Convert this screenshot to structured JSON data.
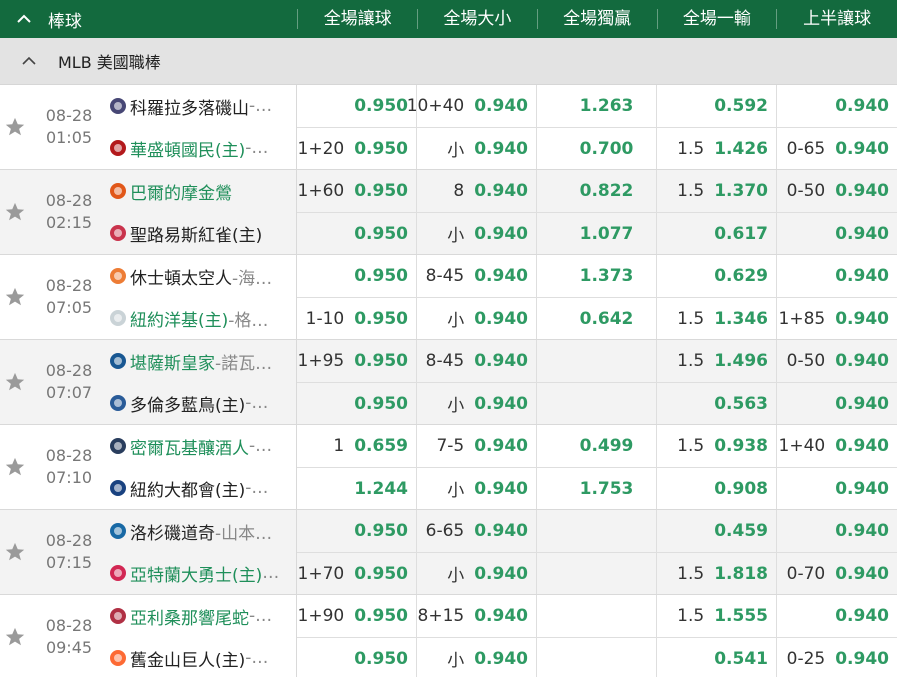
{
  "header": {
    "sport": "棒球",
    "columns": [
      "全場讓球",
      "全場大小",
      "全場獨贏",
      "全場一輸",
      "上半讓球"
    ]
  },
  "league": {
    "name": "MLB 美國職棒"
  },
  "matches": [
    {
      "date": "08-28",
      "time": "01:05",
      "teams": [
        {
          "name": "科羅拉多落磯山",
          "pitcher": " -…",
          "fav": false,
          "logo": "rockies-logo-icon"
        },
        {
          "name": "華盛頓國民(主)",
          "pitcher": " -…",
          "fav": true,
          "logo": "nationals-logo-icon"
        }
      ],
      "odds": [
        [
          {
            "line": "",
            "odds": "0.950"
          },
          {
            "line": "10+40",
            "odds": "0.940"
          },
          {
            "line": "",
            "odds": "1.263"
          },
          {
            "line": "",
            "odds": "0.592"
          },
          {
            "line": "",
            "odds": "0.940"
          }
        ],
        [
          {
            "line": "1+20",
            "odds": "0.950"
          },
          {
            "line": "小",
            "odds": "0.940"
          },
          {
            "line": "",
            "odds": "0.700"
          },
          {
            "line": "1.5",
            "odds": "1.426"
          },
          {
            "line": "0-65",
            "odds": "0.940"
          }
        ]
      ]
    },
    {
      "date": "08-28",
      "time": "02:15",
      "teams": [
        {
          "name": "巴爾的摩金鶯",
          "pitcher": "",
          "fav": true,
          "logo": "orioles-logo-icon"
        },
        {
          "name": "聖路易斯紅雀(主)",
          "pitcher": "",
          "fav": false,
          "logo": "cardinals-logo-icon"
        }
      ],
      "odds": [
        [
          {
            "line": "1+60",
            "odds": "0.950"
          },
          {
            "line": "8",
            "odds": "0.940"
          },
          {
            "line": "",
            "odds": "0.822"
          },
          {
            "line": "1.5",
            "odds": "1.370"
          },
          {
            "line": "0-50",
            "odds": "0.940"
          }
        ],
        [
          {
            "line": "",
            "odds": "0.950"
          },
          {
            "line": "小",
            "odds": "0.940"
          },
          {
            "line": "",
            "odds": "1.077"
          },
          {
            "line": "",
            "odds": "0.617"
          },
          {
            "line": "",
            "odds": "0.940"
          }
        ]
      ]
    },
    {
      "date": "08-28",
      "time": "07:05",
      "teams": [
        {
          "name": "休士頓太空人",
          "pitcher": " -海…",
          "fav": false,
          "logo": "astros-logo-icon"
        },
        {
          "name": "紐約洋基(主)",
          "pitcher": " -格…",
          "fav": true,
          "logo": "yankees-logo-icon"
        }
      ],
      "odds": [
        [
          {
            "line": "",
            "odds": "0.950"
          },
          {
            "line": "8-45",
            "odds": "0.940"
          },
          {
            "line": "",
            "odds": "1.373"
          },
          {
            "line": "",
            "odds": "0.629"
          },
          {
            "line": "",
            "odds": "0.940"
          }
        ],
        [
          {
            "line": "1-10",
            "odds": "0.950"
          },
          {
            "line": "小",
            "odds": "0.940"
          },
          {
            "line": "",
            "odds": "0.642"
          },
          {
            "line": "1.5",
            "odds": "1.346"
          },
          {
            "line": "1+85",
            "odds": "0.940"
          }
        ]
      ]
    },
    {
      "date": "08-28",
      "time": "07:07",
      "teams": [
        {
          "name": "堪薩斯皇家",
          "pitcher": " -諾瓦…",
          "fav": true,
          "logo": "royals-logo-icon"
        },
        {
          "name": "多倫多藍鳥(主)",
          "pitcher": " -…",
          "fav": false,
          "logo": "bluejays-logo-icon"
        }
      ],
      "odds": [
        [
          {
            "line": "1+95",
            "odds": "0.950"
          },
          {
            "line": "8-45",
            "odds": "0.940"
          },
          {
            "line": "",
            "odds": ""
          },
          {
            "line": "1.5",
            "odds": "1.496"
          },
          {
            "line": "0-50",
            "odds": "0.940"
          }
        ],
        [
          {
            "line": "",
            "odds": "0.950"
          },
          {
            "line": "小",
            "odds": "0.940"
          },
          {
            "line": "",
            "odds": ""
          },
          {
            "line": "",
            "odds": "0.563"
          },
          {
            "line": "",
            "odds": "0.940"
          }
        ]
      ]
    },
    {
      "date": "08-28",
      "time": "07:10",
      "teams": [
        {
          "name": "密爾瓦基釀酒人",
          "pitcher": " -…",
          "fav": true,
          "logo": "brewers-logo-icon"
        },
        {
          "name": "紐約大都會(主)",
          "pitcher": " -…",
          "fav": false,
          "logo": "mets-logo-icon"
        }
      ],
      "odds": [
        [
          {
            "line": "1",
            "odds": "0.659"
          },
          {
            "line": "7-5",
            "odds": "0.940"
          },
          {
            "line": "",
            "odds": "0.499"
          },
          {
            "line": "1.5",
            "odds": "0.938"
          },
          {
            "line": "1+40",
            "odds": "0.940"
          }
        ],
        [
          {
            "line": "",
            "odds": "1.244"
          },
          {
            "line": "小",
            "odds": "0.940"
          },
          {
            "line": "",
            "odds": "1.753"
          },
          {
            "line": "",
            "odds": "0.908"
          },
          {
            "line": "",
            "odds": "0.940"
          }
        ]
      ]
    },
    {
      "date": "08-28",
      "time": "07:15",
      "teams": [
        {
          "name": "洛杉磯道奇",
          "pitcher": " -山本…",
          "fav": false,
          "logo": "dodgers-logo-icon"
        },
        {
          "name": "亞特蘭大勇士(主)",
          "pitcher": "…",
          "fav": true,
          "logo": "braves-logo-icon"
        }
      ],
      "odds": [
        [
          {
            "line": "",
            "odds": "0.950"
          },
          {
            "line": "6-65",
            "odds": "0.940"
          },
          {
            "line": "",
            "odds": ""
          },
          {
            "line": "",
            "odds": "0.459"
          },
          {
            "line": "",
            "odds": "0.940"
          }
        ],
        [
          {
            "line": "1+70",
            "odds": "0.950"
          },
          {
            "line": "小",
            "odds": "0.940"
          },
          {
            "line": "",
            "odds": ""
          },
          {
            "line": "1.5",
            "odds": "1.818"
          },
          {
            "line": "0-70",
            "odds": "0.940"
          }
        ]
      ]
    },
    {
      "date": "08-28",
      "time": "09:45",
      "teams": [
        {
          "name": "亞利桑那響尾蛇",
          "pitcher": " -…",
          "fav": true,
          "logo": "diamondbacks-logo-icon"
        },
        {
          "name": "舊金山巨人(主)",
          "pitcher": " -…",
          "fav": false,
          "logo": "giants-logo-icon"
        }
      ],
      "odds": [
        [
          {
            "line": "1+90",
            "odds": "0.950"
          },
          {
            "line": "8+15",
            "odds": "0.940"
          },
          {
            "line": "",
            "odds": ""
          },
          {
            "line": "1.5",
            "odds": "1.555"
          },
          {
            "line": "",
            "odds": "0.940"
          }
        ],
        [
          {
            "line": "",
            "odds": "0.950"
          },
          {
            "line": "小",
            "odds": "0.940"
          },
          {
            "line": "",
            "odds": ""
          },
          {
            "line": "",
            "odds": "0.541"
          },
          {
            "line": "0-25",
            "odds": "0.940"
          }
        ]
      ]
    }
  ]
}
